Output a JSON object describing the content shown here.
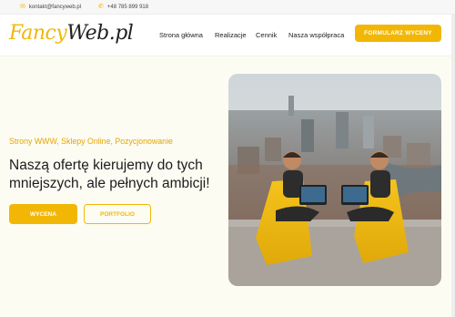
{
  "topbar": {
    "email": "kontakt@fancyweb.pl",
    "phone": "+48 785 899 918"
  },
  "logo": {
    "part1": "Fancy",
    "part2": "Web",
    "part3": ".pl"
  },
  "nav": {
    "items": [
      "Strona główna",
      "Realizacje",
      "Cennik",
      "Nasza współpraca"
    ],
    "cta_label": "FORMULARZ WYCENY"
  },
  "hero": {
    "tagline": "Strony WWW, Sklepy Online, Pozycjonowanie",
    "headline": "Naszą ofertę kierujemy do tych mniejszych, ale pełnych ambicji!",
    "primary_button": "WYCENA",
    "secondary_button": "PORTFOLIO"
  },
  "icons": {
    "email": "mail-icon",
    "phone": "phone-icon"
  },
  "colors": {
    "accent": "#f2b705",
    "hero_bg": "#fdfcf2",
    "text": "#1c1c1c"
  }
}
